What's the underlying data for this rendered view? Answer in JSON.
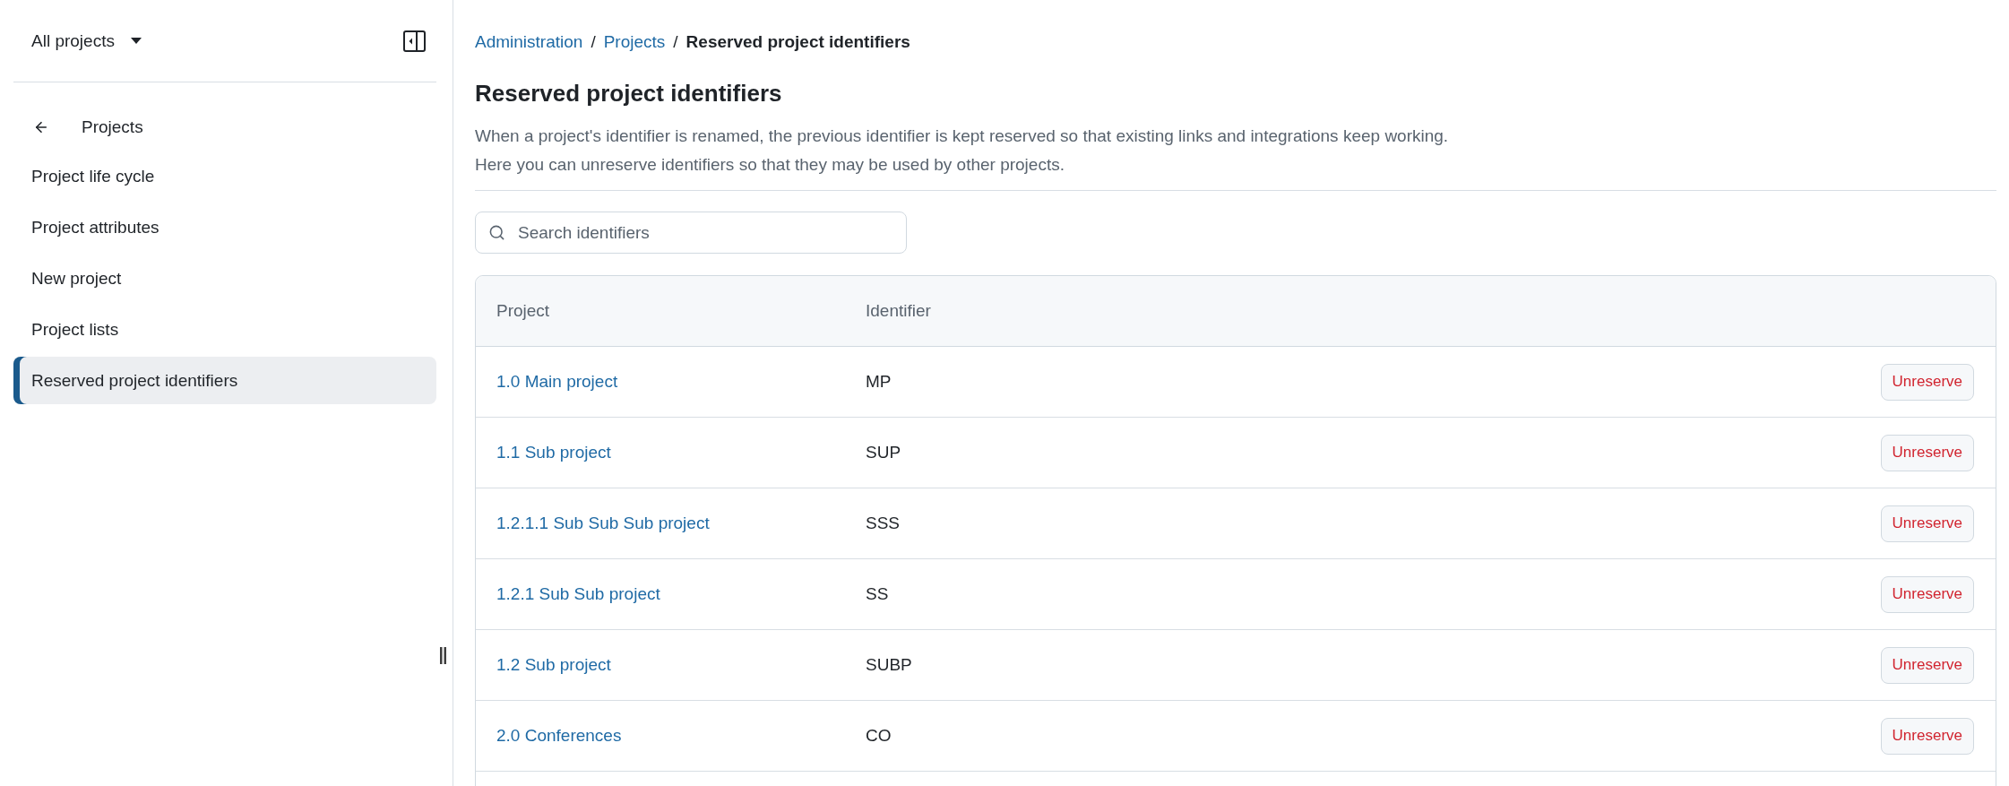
{
  "sidebar": {
    "project_selector": {
      "label": "All projects"
    },
    "back": {
      "label": "Projects"
    },
    "items": [
      {
        "label": "Project life cycle",
        "selected": false
      },
      {
        "label": "Project attributes",
        "selected": false
      },
      {
        "label": "New project",
        "selected": false
      },
      {
        "label": "Project lists",
        "selected": false
      },
      {
        "label": "Reserved project identifiers",
        "selected": true
      }
    ]
  },
  "breadcrumb": [
    {
      "label": "Administration",
      "kind": "link",
      "separator": "/"
    },
    {
      "label": "Projects",
      "kind": "link",
      "separator": "/"
    },
    {
      "label": "Reserved project identifiers",
      "kind": "current"
    }
  ],
  "page": {
    "title": "Reserved project identifiers",
    "description": [
      "When a project's identifier is renamed, the previous identifier is kept reserved so that existing links and integrations keep working.",
      "Here you can unreserve identifiers so that they may be used by other projects."
    ]
  },
  "search": {
    "placeholder": "Search identifiers"
  },
  "table": {
    "columns": [
      "Project",
      "Identifier"
    ],
    "rows": [
      {
        "project": "1.0 Main project",
        "identifier": "MP",
        "action": "Unreserve"
      },
      {
        "project": "1.1 Sub project",
        "identifier": "SUP",
        "action": "Unreserve"
      },
      {
        "project": "1.2.1.1 Sub Sub Sub project",
        "identifier": "SSS",
        "action": "Unreserve"
      },
      {
        "project": "1.2.1 Sub Sub project",
        "identifier": "SS",
        "action": "Unreserve"
      },
      {
        "project": "1.2 Sub project",
        "identifier": "SUBP",
        "action": "Unreserve"
      },
      {
        "project": "2.0 Conferences",
        "identifier": "CO",
        "action": "Unreserve"
      }
    ]
  }
}
